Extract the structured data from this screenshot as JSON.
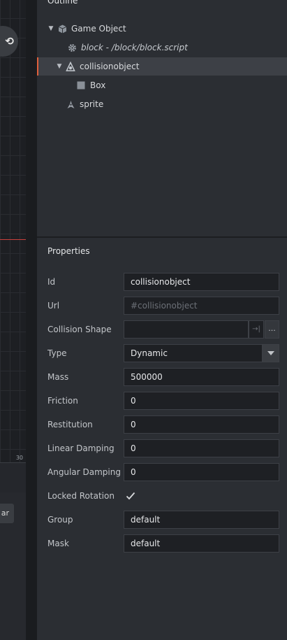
{
  "left": {
    "ruler_tick": "30",
    "bottom_button_label": "ar",
    "toolbar_icon": "refresh-icon"
  },
  "outline": {
    "title": "Outline",
    "items": [
      {
        "label": "Game Object",
        "icon": "cube-icon",
        "expanded": true
      },
      {
        "label": "block - /block/block.script",
        "icon": "gear-icon",
        "italic": true
      },
      {
        "label": "collisionobject",
        "icon": "collision-object-icon",
        "expanded": true,
        "selected": true
      },
      {
        "label": "Box",
        "icon": "box-shape-icon"
      },
      {
        "label": "sprite",
        "icon": "sprite-icon"
      }
    ]
  },
  "properties": {
    "title": "Properties",
    "id": {
      "label": "Id",
      "value": "collisionobject"
    },
    "url": {
      "label": "Url",
      "placeholder": "#collisionobject"
    },
    "collision_shape": {
      "label": "Collision Shape",
      "value": "",
      "browse_label": "..."
    },
    "type": {
      "label": "Type",
      "value": "Dynamic"
    },
    "mass": {
      "label": "Mass",
      "value": "500000"
    },
    "friction": {
      "label": "Friction",
      "value": "0"
    },
    "restitution": {
      "label": "Restitution",
      "value": "0"
    },
    "linear_damping": {
      "label": "Linear Damping",
      "value": "0"
    },
    "angular_damping": {
      "label": "Angular Damping",
      "value": "0"
    },
    "locked_rotation": {
      "label": "Locked Rotation",
      "checked": true
    },
    "group": {
      "label": "Group",
      "value": "default"
    },
    "mask": {
      "label": "Mask",
      "value": "default"
    }
  },
  "colors": {
    "selection_accent": "#e0603c",
    "canvas_axis": "#c9403c"
  }
}
